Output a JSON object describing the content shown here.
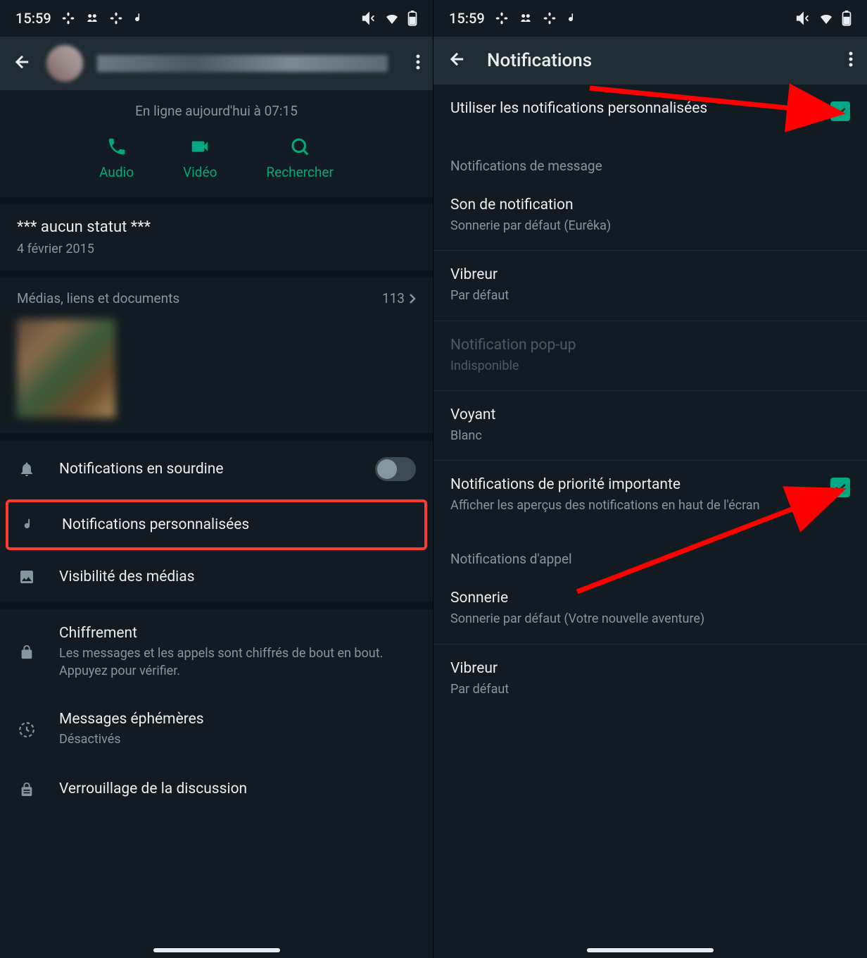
{
  "statusbar": {
    "time": "15:59"
  },
  "left": {
    "online": "En ligne aujourd'hui à 07:15",
    "actions": {
      "audio": "Audio",
      "video": "Vidéo",
      "search": "Rechercher"
    },
    "status": {
      "text": "*** aucun statut ***",
      "date": "4 février 2015"
    },
    "media": {
      "label": "Médias, liens et documents",
      "count": "113"
    },
    "settings": {
      "mute": "Notifications en sourdine",
      "custom": "Notifications personnalisées",
      "visibility": "Visibilité des médias",
      "encryption": {
        "title": "Chiffrement",
        "sub": "Les messages et les appels sont chiffrés de bout en bout. Appuyez pour vérifier."
      },
      "ephemeral": {
        "title": "Messages éphémères",
        "sub": "Désactivés"
      },
      "lock": "Verrouillage de la discussion"
    }
  },
  "right": {
    "title": "Notifications",
    "use_custom": "Utiliser les notifications personnalisées",
    "msg_header": "Notifications de message",
    "sound": {
      "title": "Son de notification",
      "sub": "Sonnerie par défaut (Eurêka)"
    },
    "vibrate": {
      "title": "Vibreur",
      "sub": "Par défaut"
    },
    "popup": {
      "title": "Notification pop-up",
      "sub": "Indisponible"
    },
    "led": {
      "title": "Voyant",
      "sub": "Blanc"
    },
    "priority": {
      "title": "Notifications de priorité importante",
      "sub": "Afficher les aperçus des notifications en haut de l'écran"
    },
    "call_header": "Notifications d'appel",
    "ringtone": {
      "title": "Sonnerie",
      "sub": "Sonnerie par défaut (Votre nouvelle aventure)"
    },
    "call_vibrate": {
      "title": "Vibreur",
      "sub": "Par défaut"
    }
  }
}
